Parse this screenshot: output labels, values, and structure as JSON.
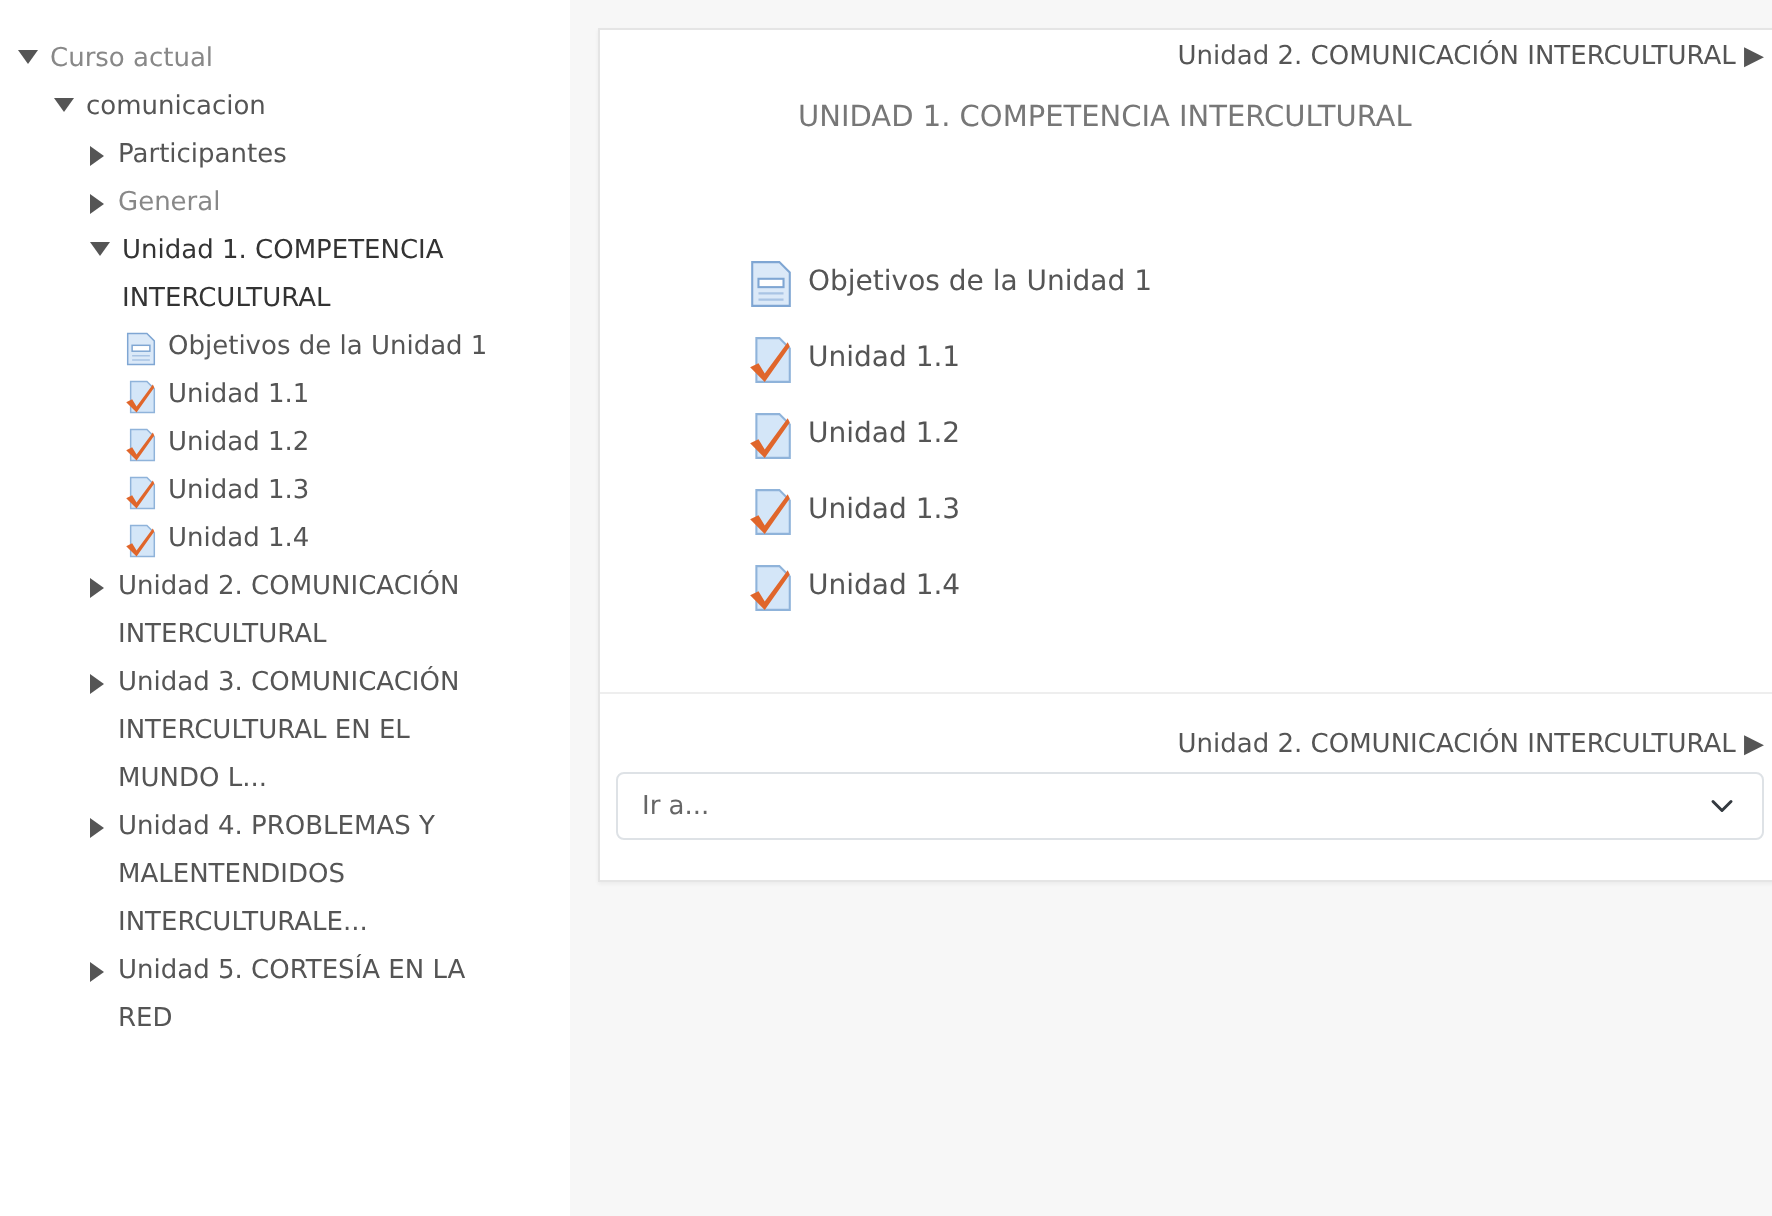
{
  "sidebar": {
    "tree": [
      {
        "label": "Curso actual",
        "kind": "branch",
        "expanded": true,
        "muted": true,
        "current": false,
        "children": [
          {
            "label": "comunicacion",
            "kind": "branch",
            "expanded": true,
            "muted": false,
            "current": false,
            "children": [
              {
                "label": "Participantes",
                "kind": "branch",
                "expanded": false,
                "muted": false,
                "current": false
              },
              {
                "label": "General",
                "kind": "branch",
                "expanded": false,
                "muted": true,
                "current": false
              },
              {
                "label": "Unidad 1. COMPETENCIA INTERCULTURAL",
                "kind": "branch",
                "expanded": true,
                "muted": false,
                "current": true,
                "children": [
                  {
                    "label": "Objetivos de la Unidad 1",
                    "kind": "page"
                  },
                  {
                    "label": "Unidad 1.1",
                    "kind": "assign"
                  },
                  {
                    "label": "Unidad 1.2",
                    "kind": "assign"
                  },
                  {
                    "label": "Unidad 1.3",
                    "kind": "assign"
                  },
                  {
                    "label": "Unidad 1.4",
                    "kind": "assign"
                  }
                ]
              },
              {
                "label": "Unidad 2. COMUNICACIÓN INTERCULTURAL",
                "kind": "branch",
                "expanded": false,
                "muted": false,
                "current": false
              },
              {
                "label": "Unidad 3. COMUNICACIÓN INTERCULTURAL EN EL MUNDO L...",
                "kind": "branch",
                "expanded": false,
                "muted": false,
                "current": false
              },
              {
                "label": "Unidad 4. PROBLEMAS Y MALENTENDIDOS INTERCULTURALE...",
                "kind": "branch",
                "expanded": false,
                "muted": false,
                "current": false
              },
              {
                "label": "Unidad 5. CORTESÍA EN LA RED",
                "kind": "branch",
                "expanded": false,
                "muted": false,
                "current": false
              }
            ]
          }
        ]
      }
    ]
  },
  "main": {
    "next_link_top": "Unidad 2. COMUNICACIÓN INTERCULTURAL",
    "next_arrow_top": "▶",
    "section_title": "UNIDAD 1. COMPETENCIA INTERCULTURAL",
    "activities": [
      {
        "label": "Objetivos de la Unidad 1",
        "kind": "page"
      },
      {
        "label": "Unidad 1.1",
        "kind": "assign"
      },
      {
        "label": "Unidad 1.2",
        "kind": "assign"
      },
      {
        "label": "Unidad 1.3",
        "kind": "assign"
      },
      {
        "label": "Unidad 1.4",
        "kind": "assign"
      }
    ],
    "next_link_bottom": "Unidad 2. COMUNICACIÓN INTERCULTURAL",
    "next_arrow_bottom": "▶",
    "jump_select": {
      "value": "Ir a..."
    }
  }
}
